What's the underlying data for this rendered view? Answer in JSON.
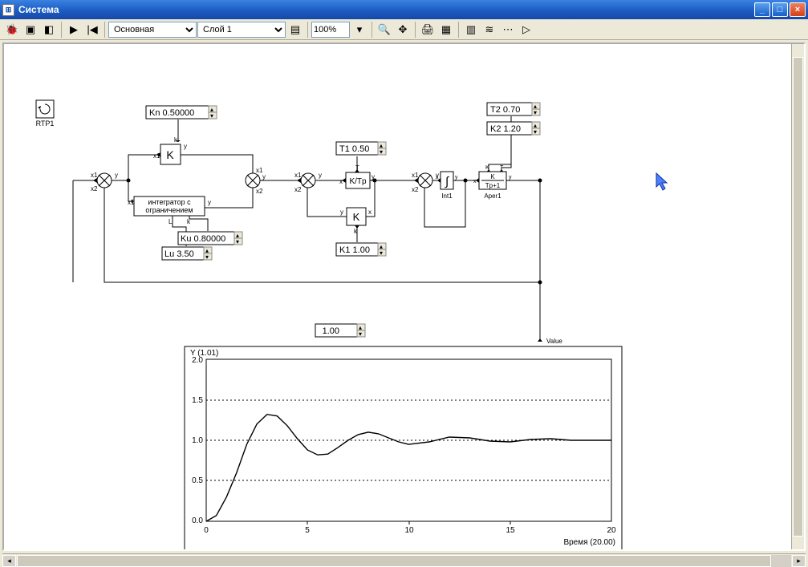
{
  "window": {
    "title": "Система"
  },
  "toolbar": {
    "select_sheet_options": [
      "Основная"
    ],
    "select_sheet": "Основная",
    "select_layer_options": [
      "Слой 1"
    ],
    "select_layer": "Слой 1",
    "zoom": "100%"
  },
  "rtp_block": {
    "label": "RTP1"
  },
  "params": {
    "Kn": {
      "name": "Kn",
      "value": "0.50000"
    },
    "Ku": {
      "name": "Ku",
      "value": "0.80000"
    },
    "Lu": {
      "name": "Lu",
      "value": "3.50"
    },
    "T1": {
      "name": "T1",
      "value": "0.50"
    },
    "K1": {
      "name": "K1",
      "value": "1.00"
    },
    "T2": {
      "name": "T2",
      "value": "0.70"
    },
    "K2": {
      "name": "K2",
      "value": "1.20"
    },
    "const1": {
      "value": "1.00"
    }
  },
  "blocks": {
    "gain_k": "K",
    "integrator_limited": "интегратор с ограничением",
    "k_over_tp": "K/Tp",
    "gain_k2": "K",
    "int1_symbol": "∫",
    "int1_label": "Int1",
    "aper1_top": "K",
    "aper1_bot": "Tp+1",
    "aper1_label": "Aper1",
    "value_label": "Value"
  },
  "ports": {
    "x1": "x1",
    "x2": "x2",
    "y": "y",
    "k": "k",
    "l": "L",
    "t": "T",
    "K": "K"
  },
  "chart": {
    "y_title": "Y (1.01)",
    "x_title": "Время (20.00)",
    "y_ticks": [
      "0.0",
      "0.5",
      "1.0",
      "1.5",
      "2.0"
    ],
    "x_ticks": [
      "0",
      "5",
      "10",
      "15",
      "20"
    ]
  },
  "chart_data": {
    "type": "line",
    "title": "Y (1.01)",
    "xlabel": "Время",
    "x_max_note": "20.00",
    "ylabel": "Y",
    "xlim": [
      0,
      20
    ],
    "ylim": [
      0.0,
      2.0
    ],
    "series": [
      {
        "name": "Y",
        "x": [
          0.0,
          0.5,
          1.0,
          1.5,
          2.0,
          2.5,
          3.0,
          3.5,
          4.0,
          4.5,
          5.0,
          5.5,
          6.0,
          6.5,
          7.0,
          7.5,
          8.0,
          8.5,
          9.0,
          9.5,
          10.0,
          11.0,
          12.0,
          13.0,
          14.0,
          15.0,
          16.0,
          17.0,
          18.0,
          19.0,
          20.0
        ],
        "y": [
          0.0,
          0.07,
          0.3,
          0.6,
          0.95,
          1.2,
          1.32,
          1.3,
          1.18,
          1.02,
          0.88,
          0.82,
          0.83,
          0.91,
          1.0,
          1.07,
          1.1,
          1.08,
          1.03,
          0.98,
          0.95,
          0.98,
          1.04,
          1.03,
          0.99,
          0.98,
          1.01,
          1.02,
          1.0,
          1.0,
          1.0
        ]
      }
    ]
  }
}
